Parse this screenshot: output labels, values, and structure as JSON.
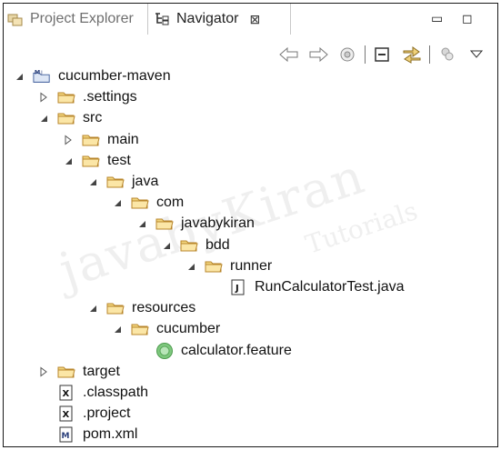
{
  "tabs": {
    "inactive_label": "Project Explorer",
    "active_label": "Navigator",
    "close_glyph": "⊠"
  },
  "view_controls": {
    "minimize": "▭",
    "maximize": "◻"
  },
  "toolbar": {
    "icons": [
      "back-arrow-icon",
      "forward-arrow-icon",
      "go-into-icon",
      "collapse-all-icon",
      "link-with-editor-icon",
      "view-filter-icon",
      "view-menu-icon"
    ]
  },
  "tree": {
    "items": [
      {
        "label": "cucumber-maven",
        "depth": 0,
        "twisty": "expanded",
        "icon": "maven-project-icon"
      },
      {
        "label": ".settings",
        "depth": 1,
        "twisty": "collapsed",
        "icon": "folder-icon"
      },
      {
        "label": "src",
        "depth": 1,
        "twisty": "expanded",
        "icon": "folder-icon"
      },
      {
        "label": "main",
        "depth": 2,
        "twisty": "collapsed",
        "icon": "folder-icon"
      },
      {
        "label": "test",
        "depth": 2,
        "twisty": "expanded",
        "icon": "folder-icon"
      },
      {
        "label": "java",
        "depth": 3,
        "twisty": "expanded",
        "icon": "folder-icon"
      },
      {
        "label": "com",
        "depth": 4,
        "twisty": "expanded",
        "icon": "folder-icon"
      },
      {
        "label": "javabykiran",
        "depth": 5,
        "twisty": "expanded",
        "icon": "folder-icon"
      },
      {
        "label": "bdd",
        "depth": 6,
        "twisty": "expanded",
        "icon": "folder-icon"
      },
      {
        "label": "runner",
        "depth": 7,
        "twisty": "expanded",
        "icon": "folder-icon"
      },
      {
        "label": "RunCalculatorTest.java",
        "depth": 8,
        "twisty": "none",
        "icon": "java-file-icon"
      },
      {
        "label": "resources",
        "depth": 3,
        "twisty": "expanded",
        "icon": "folder-icon"
      },
      {
        "label": "cucumber",
        "depth": 4,
        "twisty": "expanded",
        "icon": "folder-icon"
      },
      {
        "label": "calculator.feature",
        "depth": 5,
        "twisty": "none",
        "icon": "feature-file-icon"
      },
      {
        "label": "target",
        "depth": 1,
        "twisty": "collapsed",
        "icon": "folder-icon"
      },
      {
        "label": ".classpath",
        "depth": 1,
        "twisty": "none",
        "icon": "xml-file-icon"
      },
      {
        "label": ".project",
        "depth": 1,
        "twisty": "none",
        "icon": "xml-file-icon"
      },
      {
        "label": "pom.xml",
        "depth": 1,
        "twisty": "none",
        "icon": "pom-file-icon"
      }
    ]
  },
  "watermark": {
    "main": "javabyKiran",
    "sub": "Tutorials"
  },
  "colors": {
    "folder_fill": "#f2d57e",
    "folder_stroke": "#b8862b",
    "feature_green": "#7ec87e"
  }
}
